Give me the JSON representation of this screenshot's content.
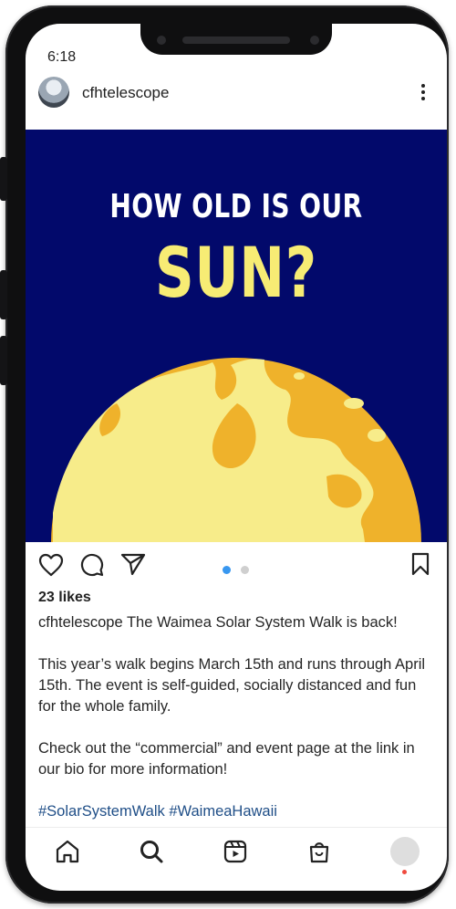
{
  "status_bar": {
    "time": "6:18"
  },
  "post": {
    "username": "cfhtelescope",
    "image": {
      "headline_line1": "HOW OLD IS OUR",
      "headline_line2": "SUN?",
      "colors": {
        "background": "#02096b",
        "sun_base": "#efb22b",
        "sun_spots": "#f7ec8a",
        "headline1": "#ffffff",
        "headline2": "#f7ec74"
      }
    },
    "carousel": {
      "total": 2,
      "active": 1
    },
    "likes": "23 likes",
    "caption": {
      "username": "cfhtelescope",
      "line1": "The Waimea Solar System Walk is back!",
      "paragraph2": "This year’s walk begins March 15th and runs through April 15th.  The event is self-guided, socially distanced and fun for the whole family.",
      "paragraph3": "Check out the “commercial” and event page at the link in our bio for more information!",
      "hashtags": "#SolarSystemWalk #WaimeaHawaii"
    }
  },
  "actions": {
    "icons": [
      "heart-icon",
      "comment-icon",
      "share-icon",
      "bookmark-icon"
    ]
  },
  "bottom_nav": {
    "items": [
      "home-icon",
      "search-icon",
      "reels-icon",
      "shop-icon",
      "profile-avatar"
    ]
  }
}
